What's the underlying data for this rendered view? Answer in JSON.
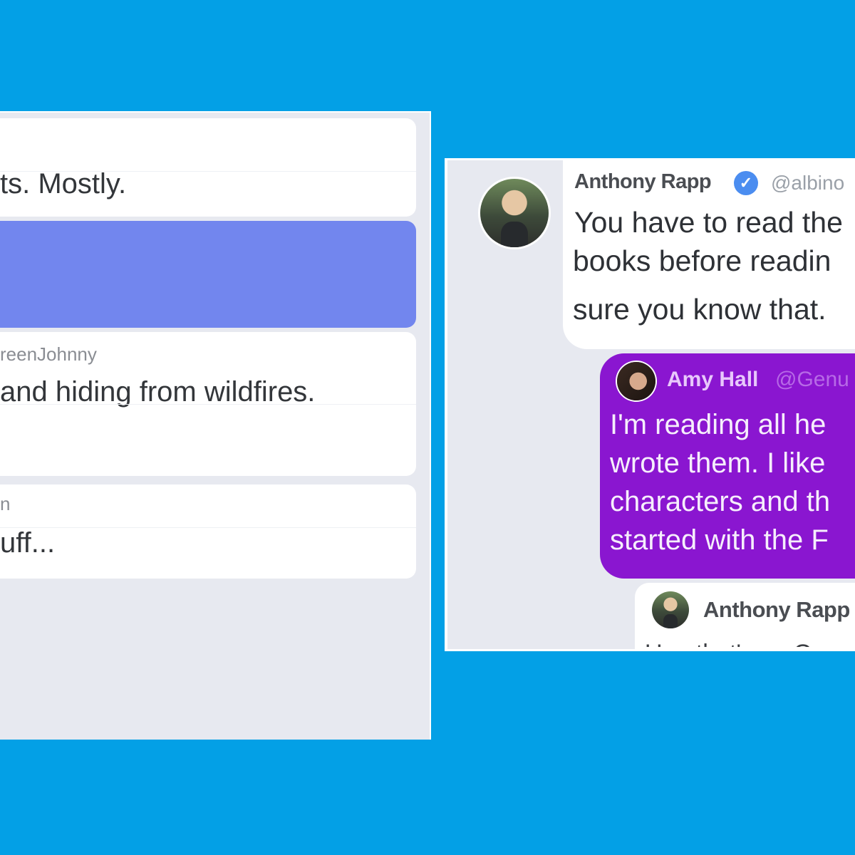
{
  "colors": {
    "background": "#03a0e6",
    "panel": "#e7e9f0",
    "highlight": "#7286ee",
    "amy_bubble": "#8a16d0",
    "verified": "#4b8df0"
  },
  "left_panel": {
    "card1": {
      "text": "ts. Mostly."
    },
    "card3": {
      "handle": "reenJohnny",
      "text": "and hiding from wildfires."
    },
    "card4": {
      "handle": "n",
      "text": "uff..."
    }
  },
  "right_panel": {
    "tweet": {
      "author": "Anthony Rapp",
      "handle": "@albino",
      "lines": [
        "You have to read the",
        "books before readin",
        "sure you know that."
      ]
    },
    "reply": {
      "author": "Amy Hall",
      "handle": "@Genu",
      "lines": [
        "I'm reading all he",
        "wrote them.  I like",
        "characters and th",
        "started with the F"
      ]
    },
    "reply2": {
      "author": "Anthony Rapp",
      "partial": "Um, that's an O"
    }
  }
}
